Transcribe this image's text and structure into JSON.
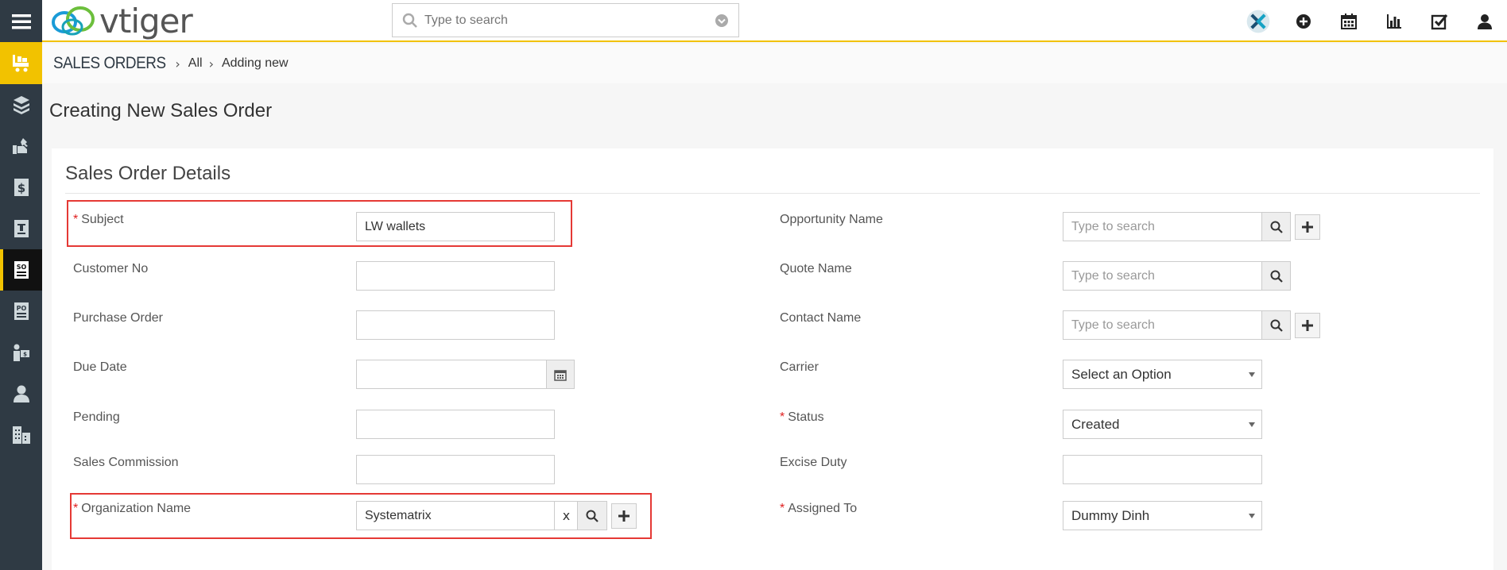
{
  "app": {
    "logo_text": "vtiger",
    "search_placeholder": "Type to search"
  },
  "topbar": {
    "icons": [
      "x-integration-icon",
      "plus-circle-icon",
      "calendar-icon",
      "bar-chart-icon",
      "checkbox-icon",
      "user-icon"
    ]
  },
  "sidebar": {
    "items": [
      "menu-icon",
      "sales-orders-icon",
      "products-icon",
      "services-icon",
      "invoices-icon",
      "pricebooks-icon",
      "sales-order-icon",
      "purchase-order-icon",
      "vendors-icon",
      "contacts-icon",
      "organizations-icon"
    ]
  },
  "breadcrumb": {
    "module": "SALES ORDERS",
    "all": "All",
    "current": "Adding new"
  },
  "page": {
    "title": "Creating New Sales Order"
  },
  "section": {
    "title": "Sales Order Details"
  },
  "form": {
    "subject": {
      "label": "Subject",
      "value": "LW wallets",
      "required": "*"
    },
    "customer_no": {
      "label": "Customer No",
      "value": ""
    },
    "purchase_order": {
      "label": "Purchase Order",
      "value": ""
    },
    "due_date": {
      "label": "Due Date",
      "value": ""
    },
    "pending": {
      "label": "Pending",
      "value": ""
    },
    "sales_commission": {
      "label": "Sales Commission",
      "value": ""
    },
    "organization_name": {
      "label": "Organization Name",
      "value": "Systematrix",
      "clear": "x",
      "required": "*"
    },
    "opportunity_name": {
      "label": "Opportunity Name",
      "placeholder": "Type to search"
    },
    "quote_name": {
      "label": "Quote Name",
      "placeholder": "Type to search"
    },
    "contact_name": {
      "label": "Contact Name",
      "placeholder": "Type to search"
    },
    "carrier": {
      "label": "Carrier",
      "value": "Select an Option"
    },
    "status": {
      "label": "Status",
      "value": "Created",
      "required": "*"
    },
    "excise_duty": {
      "label": "Excise Duty",
      "value": ""
    },
    "assigned_to": {
      "label": "Assigned To",
      "value": "Dummy Dinh",
      "required": "*"
    }
  },
  "colors": {
    "sidebar_bg": "#2f3a44",
    "accent": "#f2c200",
    "highlight": "#e53935",
    "required": "#e02020"
  }
}
